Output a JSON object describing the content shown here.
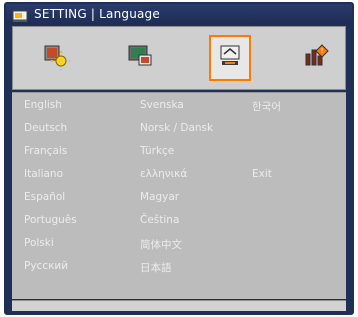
{
  "window": {
    "title": "SETTING | Language"
  },
  "tabs": [
    {
      "name": "image-settings",
      "icon": "image-settings-icon",
      "selected": false
    },
    {
      "name": "display-settings",
      "icon": "display-settings-icon",
      "selected": false
    },
    {
      "name": "setting",
      "icon": "setting-icon",
      "selected": true
    },
    {
      "name": "options",
      "icon": "options-icon",
      "selected": false
    }
  ],
  "languages": {
    "col1": [
      "English",
      "Deutsch",
      "Français",
      "Italiano",
      "Español",
      "Português",
      "Polski",
      "Русский"
    ],
    "col2": [
      "Svenska",
      "Norsk / Dansk",
      "Türkçe",
      "ελληνικά",
      "Magyar",
      "Čeština",
      "简体中文",
      "日本語"
    ],
    "col3": [
      "한국어"
    ]
  },
  "exit_label": "Exit",
  "colors": {
    "frame": "#1f2f55",
    "panel": "#bcbcbc",
    "selected_border": "#ff7a00",
    "option_text": "#ececec"
  }
}
